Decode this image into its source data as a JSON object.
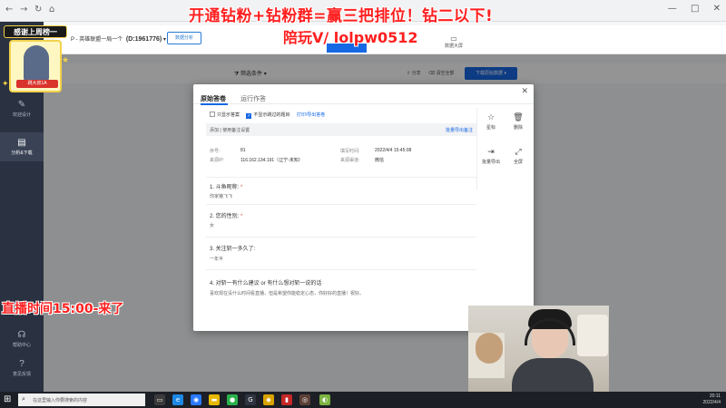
{
  "window": {
    "controls": [
      "—",
      "□",
      "✕"
    ]
  },
  "app": {
    "project_title": "P - 英雄联盟一局一个",
    "project_id": "(D:1961776)",
    "header_button": "数据分析",
    "header_tab2": "数据大屏"
  },
  "sidebar": {
    "items": [
      {
        "label": "欢迎设计"
      },
      {
        "label": "分析&下载"
      },
      {
        "label": "帮助中心"
      },
      {
        "label": "意见反馈"
      }
    ]
  },
  "toolbar": {
    "filter": "筛选条件",
    "share": "分享",
    "clear": "清空全部",
    "download": "下载原始数据"
  },
  "modal": {
    "tabs": [
      "原始答卷",
      "运行作答"
    ],
    "options": {
      "only_show_answered": "只显示答案",
      "not_show_skipped": "不显示跳过的题目",
      "print_link": "打印/导出答卷"
    },
    "infobar": {
      "left": "添加 | 使用备注设置",
      "right": "批量导出备注"
    },
    "meta": {
      "seq_label": "序号:",
      "seq_value": "81",
      "ip_label": "来源IP:",
      "ip_value": "116.162.134.191（辽宁-未知）",
      "time_label": "填写时间:",
      "time_value": "2022/4/4 15:45:08",
      "channel_label": "来源渠道:",
      "channel_value": "微信"
    },
    "questions": [
      {
        "q": "1. 斗鱼昵称:",
        "a": "你家猪飞飞"
      },
      {
        "q": "2. 您的性别:",
        "a": "女"
      },
      {
        "q": "3. 关注斩一多久了:",
        "a": "一年半"
      },
      {
        "q": "4. 对斩一有什么建议 or 有什么想对斩一说的话",
        "a": "喜欢现在没什么时间看直播，但是希望你能稳定心态，你好好的直播！祝好。"
      }
    ],
    "side_actions": [
      {
        "label": "星标",
        "icon": "star-icon"
      },
      {
        "label": "删除",
        "icon": "trash-icon"
      },
      {
        "label": "批量导出",
        "icon": "export-icon"
      },
      {
        "label": "全屏",
        "icon": "fullscreen-icon"
      }
    ]
  },
  "stream": {
    "banner_line1": "开通钻粉+钻粉群=赢三把排位！钻二以下!",
    "banner_line2": "陪玩V/ lolpw0512",
    "live_time": "直播时间15:00-来了",
    "thanks_title": "感谢上周榜一",
    "thanks_name": "跳大叔1A"
  },
  "taskbar": {
    "search_placeholder": "在这里输入你要搜索的内容",
    "time": "20:11",
    "date": "2022/4/4"
  },
  "colors": {
    "accent": "#1768e4",
    "banner_red": "#ff1f1f",
    "sidebar": "#2a3140"
  }
}
